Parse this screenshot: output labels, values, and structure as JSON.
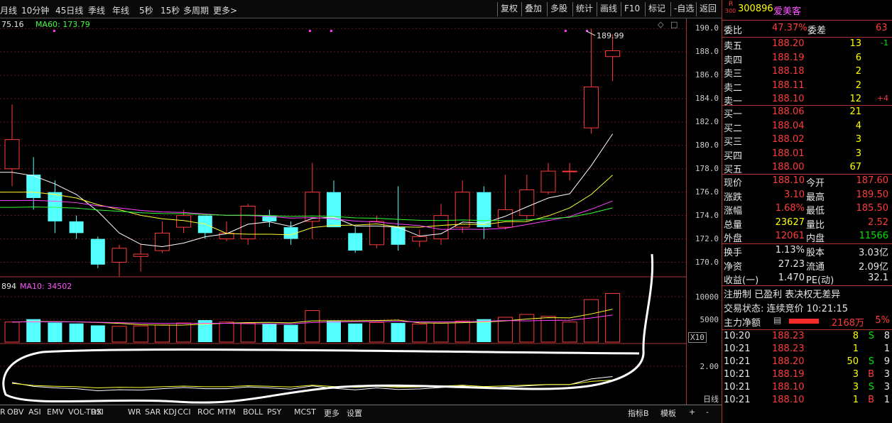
{
  "toolbar": {
    "periods": [
      "月线",
      "10分钟",
      "45日线",
      "季线",
      "年线",
      "5秒",
      "15秒",
      "多周期",
      "更多>"
    ],
    "buttons": [
      "复权",
      "叠加",
      "多股",
      "统计",
      "画线",
      "F10",
      "标记",
      "-自选",
      "返回"
    ]
  },
  "price_chart": {
    "ma_legend": [
      {
        "label": "75.16",
        "color": "#e6e6e6"
      },
      {
        "label": "MA60: 173.79",
        "color": "#44ff44"
      }
    ],
    "y_ticks": [
      "190.0",
      "188.0",
      "186.0",
      "184.0",
      "182.0",
      "180.0",
      "178.0",
      "176.0",
      "174.0",
      "172.0",
      "170.0"
    ],
    "high_annotation": "189.99",
    "high_marker_icon": "arrow-icon"
  },
  "volume_chart": {
    "legend": [
      {
        "label": "894",
        "color": "#e6e6e6"
      },
      {
        "label": "MA10: 34502",
        "color": "#ff55ff"
      }
    ],
    "y_ticks": [
      "10000",
      "5000"
    ],
    "unit": "X10"
  },
  "indicator_chart": {
    "y_ticks": [
      "2.00"
    ],
    "period_label": "日线"
  },
  "chart_data": {
    "type": "candlestick",
    "ylim": [
      169,
      190.5
    ],
    "candles": [
      {
        "o": 178.0,
        "c": 180.5,
        "h": 183.5,
        "l": 176.5
      },
      {
        "o": 177.5,
        "c": 175.5,
        "h": 179.0,
        "l": 174.5
      },
      {
        "o": 176.0,
        "c": 173.5,
        "h": 177.0,
        "l": 172.5
      },
      {
        "o": 173.5,
        "c": 172.5,
        "h": 174.0,
        "l": 172.0
      },
      {
        "o": 172.0,
        "c": 169.8,
        "h": 172.2,
        "l": 169.5
      },
      {
        "o": 170.0,
        "c": 171.2,
        "h": 171.5,
        "l": 168.8
      },
      {
        "o": 170.5,
        "c": 170.7,
        "h": 171.5,
        "l": 169.2
      },
      {
        "o": 171.0,
        "c": 172.5,
        "h": 173.5,
        "l": 170.8
      },
      {
        "o": 173.0,
        "c": 174.0,
        "h": 174.5,
        "l": 172.5
      },
      {
        "o": 174.0,
        "c": 172.5,
        "h": 174.0,
        "l": 172.0
      },
      {
        "o": 172.0,
        "c": 172.5,
        "h": 173.5,
        "l": 171.8
      },
      {
        "o": 172.0,
        "c": 174.8,
        "h": 175.0,
        "l": 171.5
      },
      {
        "o": 174.0,
        "c": 173.5,
        "h": 174.5,
        "l": 173.0
      },
      {
        "o": 173.0,
        "c": 172.0,
        "h": 173.5,
        "l": 171.5
      },
      {
        "o": 173.5,
        "c": 176.0,
        "h": 178.5,
        "l": 172.0
      },
      {
        "o": 176.0,
        "c": 173.0,
        "h": 177.0,
        "l": 173.0
      },
      {
        "o": 172.5,
        "c": 171.0,
        "h": 173.0,
        "l": 170.8
      },
      {
        "o": 171.5,
        "c": 173.5,
        "h": 174.0,
        "l": 171.2
      },
      {
        "o": 173.0,
        "c": 171.5,
        "h": 176.5,
        "l": 171.0
      },
      {
        "o": 171.8,
        "c": 172.2,
        "h": 172.8,
        "l": 171.3
      },
      {
        "o": 172.0,
        "c": 174.0,
        "h": 175.0,
        "l": 171.5
      },
      {
        "o": 173.0,
        "c": 176.0,
        "h": 177.0,
        "l": 172.5
      },
      {
        "o": 176.0,
        "c": 173.0,
        "h": 176.5,
        "l": 172.0
      },
      {
        "o": 173.0,
        "c": 174.5,
        "h": 177.5,
        "l": 172.8
      },
      {
        "o": 174.0,
        "c": 176.2,
        "h": 177.5,
        "l": 173.5
      },
      {
        "o": 176.0,
        "c": 177.8,
        "h": 178.5,
        "l": 175.8
      },
      {
        "o": 177.8,
        "c": 177.8,
        "h": 178.5,
        "l": 177.0
      },
      {
        "o": 181.5,
        "c": 185.0,
        "h": 189.99,
        "l": 181.0
      },
      {
        "o": 187.6,
        "c": 188.1,
        "h": 189.5,
        "l": 185.5
      }
    ],
    "volume": [
      4200,
      4800,
      4100,
      3900,
      3500,
      3300,
      3400,
      3600,
      4000,
      4600,
      4200,
      4000,
      3800,
      3600,
      6600,
      4400,
      3900,
      4100,
      4000,
      3800,
      4000,
      4400,
      4800,
      5200,
      5800,
      5400,
      4200,
      8900,
      10200
    ]
  },
  "panel": {
    "board_tag": "R",
    "index_tag": "300",
    "code": "300896",
    "name": "爱美客",
    "weibi_label": "委比",
    "weibi_value": "47.37%",
    "weicha_label": "委差",
    "weicha_value": "63",
    "asks": [
      {
        "label": "卖五",
        "price": "188.20",
        "vol": "13",
        "chg": "-1"
      },
      {
        "label": "卖四",
        "price": "188.19",
        "vol": "6",
        "chg": ""
      },
      {
        "label": "卖三",
        "price": "188.18",
        "vol": "2",
        "chg": ""
      },
      {
        "label": "卖二",
        "price": "188.11",
        "vol": "2",
        "chg": ""
      },
      {
        "label": "卖一",
        "price": "188.10",
        "vol": "12",
        "chg": "+4"
      }
    ],
    "bids": [
      {
        "label": "买一",
        "price": "188.06",
        "vol": "21"
      },
      {
        "label": "买二",
        "price": "188.04",
        "vol": "4"
      },
      {
        "label": "买三",
        "price": "188.02",
        "vol": "3"
      },
      {
        "label": "买四",
        "price": "188.01",
        "vol": "3"
      },
      {
        "label": "买五",
        "price": "188.00",
        "vol": "67"
      }
    ],
    "quotes": [
      {
        "l1": "现价",
        "v1": "188.10",
        "c1": "red",
        "l2": "今开",
        "v2": "187.60",
        "c2": "red"
      },
      {
        "l1": "涨跌",
        "v1": "3.10",
        "c1": "red",
        "l2": "最高",
        "v2": "189.50",
        "c2": "red"
      },
      {
        "l1": "涨幅",
        "v1": "1.68%",
        "c1": "red",
        "l2": "最低",
        "v2": "185.50",
        "c2": "red"
      },
      {
        "l1": "总量",
        "v1": "23627",
        "c1": "yellow",
        "l2": "量比",
        "v2": "2.52",
        "c2": "red"
      },
      {
        "l1": "外盘",
        "v1": "12061",
        "c1": "red",
        "l2": "内盘",
        "v2": "11566",
        "c2": "green"
      }
    ],
    "fund": [
      {
        "l1": "换手",
        "v1": "1.13%",
        "l2": "股本",
        "v2": "3.03亿"
      },
      {
        "l1": "净资",
        "v1": "27.23",
        "l2": "流通",
        "v2": "2.09亿"
      },
      {
        "l1": "收益(一)",
        "v1": "1.470",
        "l2": "PE(动)",
        "v2": "32.1"
      }
    ],
    "notice": "注册制 已盈利 表决权无差异",
    "status": "交易状态: 连续竞价 10:21:15",
    "main_force_label": "主力净额",
    "main_force_value": "2168万",
    "main_force_pct": "5%",
    "ticks": [
      {
        "time": "10:20",
        "price": "188.23",
        "vol": "8",
        "side": "S",
        "n": "8"
      },
      {
        "time": "10:21",
        "price": "188.23",
        "vol": "1",
        "side": "",
        "n": "1"
      },
      {
        "time": "10:21",
        "price": "188.20",
        "vol": "50",
        "side": "S",
        "n": "9"
      },
      {
        "time": "10:21",
        "price": "188.19",
        "vol": "3",
        "side": "B",
        "n": "3"
      },
      {
        "time": "10:21",
        "price": "188.10",
        "vol": "3",
        "side": "S",
        "n": "3"
      },
      {
        "time": "10:21",
        "price": "188.10",
        "vol": "1",
        "side": "B",
        "n": "1"
      }
    ]
  },
  "bottom_tabs": {
    "tabs": [
      "R",
      "OBV",
      "ASI",
      "EMV",
      "VOL-TDX",
      "RSI",
      "WR",
      "SAR",
      "KDJ",
      "CCI",
      "ROC",
      "MTM",
      "BOLL",
      "PSY",
      "MCST",
      "更多",
      "设置"
    ],
    "right_buttons": [
      "指标B",
      "模板",
      "+",
      "-"
    ]
  }
}
